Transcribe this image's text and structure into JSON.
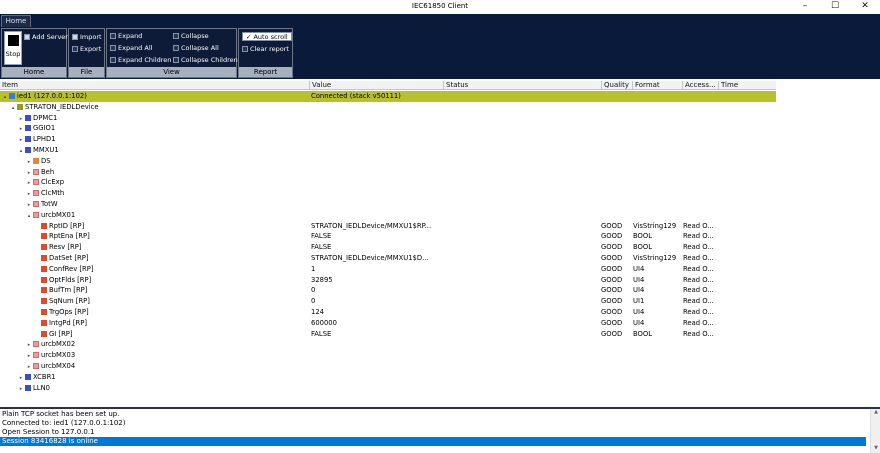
{
  "window": {
    "title": "IEC61850 Client",
    "minimize": "–",
    "maximize": "☐",
    "close": "✕"
  },
  "ribbon": {
    "tab": "Home",
    "groups": {
      "home": {
        "label": "Home",
        "stop": "Stop",
        "add_server": "Add Server"
      },
      "file": {
        "label": "File",
        "import": "Import",
        "export": "Export"
      },
      "view": {
        "label": "View",
        "expand": "Expand",
        "expand_all": "Expand All",
        "expand_children": "Expand Children",
        "collapse": "Collapse",
        "collapse_all": "Collapse All",
        "collapse_children": "Collapse Children"
      },
      "report": {
        "label": "Report",
        "auto_scroll": "Auto scroll",
        "clear_report": "Clear report"
      }
    }
  },
  "columns": [
    "Item",
    "Value",
    "Status",
    "Quality",
    "Format",
    "Access...",
    "Time"
  ],
  "tree": [
    {
      "level": 0,
      "expander": "▴",
      "icon": "none",
      "name": "ied1 (127.0.0.1:102)",
      "value": "Connected (stack v50111)",
      "quality": "",
      "format": "",
      "access": "",
      "selected": true
    },
    {
      "level": 1,
      "expander": "▴",
      "icon": "olive",
      "name": "STRATON_IEDLDevice"
    },
    {
      "level": 2,
      "expander": "▸",
      "icon": "blue",
      "name": "DPMC1"
    },
    {
      "level": 2,
      "expander": "▸",
      "icon": "blue",
      "name": "GGIO1"
    },
    {
      "level": 2,
      "expander": "▸",
      "icon": "blue",
      "name": "LPHD1"
    },
    {
      "level": 2,
      "expander": "▴",
      "icon": "blue",
      "name": "MMXU1"
    },
    {
      "level": 3,
      "expander": "▸",
      "icon": "orange",
      "name": "DS"
    },
    {
      "level": 3,
      "expander": "▸",
      "icon": "pink",
      "name": "Beh"
    },
    {
      "level": 3,
      "expander": "▸",
      "icon": "pink",
      "name": "ClcExp"
    },
    {
      "level": 3,
      "expander": "▸",
      "icon": "pink",
      "name": "ClcMth"
    },
    {
      "level": 3,
      "expander": "▸",
      "icon": "pink",
      "name": "TotW"
    },
    {
      "level": 3,
      "expander": "▴",
      "icon": "pink",
      "name": "urcbMX01"
    },
    {
      "level": 4,
      "expander": "",
      "icon": "red",
      "name": "RptID [RP]",
      "value": "STRATON_IEDLDevice/MMXU1$RP...",
      "quality": "GOOD",
      "format": "VisString129",
      "access": "Read O..."
    },
    {
      "level": 4,
      "expander": "",
      "icon": "red",
      "name": "RptEna [RP]",
      "value": "FALSE",
      "quality": "GOOD",
      "format": "BOOL",
      "access": "Read O..."
    },
    {
      "level": 4,
      "expander": "",
      "icon": "red",
      "name": "Resv [RP]",
      "value": "FALSE",
      "quality": "GOOD",
      "format": "BOOL",
      "access": "Read O..."
    },
    {
      "level": 4,
      "expander": "",
      "icon": "red",
      "name": "DatSet [RP]",
      "value": "STRATON_IEDLDevice/MMXU1$D...",
      "quality": "GOOD",
      "format": "VisString129",
      "access": "Read O..."
    },
    {
      "level": 4,
      "expander": "",
      "icon": "red",
      "name": "ConfRev [RP]",
      "value": "1",
      "quality": "GOOD",
      "format": "UI4",
      "access": "Read O..."
    },
    {
      "level": 4,
      "expander": "",
      "icon": "red",
      "name": "OptFlds [RP]",
      "value": "32895",
      "quality": "GOOD",
      "format": "UI4",
      "access": "Read O..."
    },
    {
      "level": 4,
      "expander": "",
      "icon": "red",
      "name": "BufTm [RP]",
      "value": "0",
      "quality": "GOOD",
      "format": "UI4",
      "access": "Read O..."
    },
    {
      "level": 4,
      "expander": "",
      "icon": "red",
      "name": "SqNum [RP]",
      "value": "0",
      "quality": "GOOD",
      "format": "UI1",
      "access": "Read O..."
    },
    {
      "level": 4,
      "expander": "",
      "icon": "red",
      "name": "TrgOps [RP]",
      "value": "124",
      "quality": "GOOD",
      "format": "UI4",
      "access": "Read O..."
    },
    {
      "level": 4,
      "expander": "",
      "icon": "red",
      "name": "IntgPd [RP]",
      "value": "600000",
      "quality": "GOOD",
      "format": "UI4",
      "access": "Read O..."
    },
    {
      "level": 4,
      "expander": "",
      "icon": "red",
      "name": "GI [RP]",
      "value": "FALSE",
      "quality": "GOOD",
      "format": "BOOL",
      "access": "Read O..."
    },
    {
      "level": 3,
      "expander": "▸",
      "icon": "pink",
      "name": "urcbMX02"
    },
    {
      "level": 3,
      "expander": "▸",
      "icon": "pink",
      "name": "urcbMX03"
    },
    {
      "level": 3,
      "expander": "▸",
      "icon": "pink",
      "name": "urcbMX04"
    },
    {
      "level": 2,
      "expander": "▸",
      "icon": "blue",
      "name": "XCBR1"
    },
    {
      "level": 2,
      "expander": "▸",
      "icon": "blue",
      "name": "LLN0"
    }
  ],
  "log": [
    {
      "text": "Plain TCP socket has been set up.",
      "selected": false
    },
    {
      "text": "Connected to: ied1 (127.0.0.1:102)",
      "selected": false
    },
    {
      "text": "Open Session to 127.0.0.1",
      "selected": false
    },
    {
      "text": "Session 83416828 is online",
      "selected": true
    }
  ],
  "colors": {
    "ribbon_bg": "#0a1a3a",
    "selected_row": "#b6c12c",
    "log_selected": "#0078d7"
  }
}
